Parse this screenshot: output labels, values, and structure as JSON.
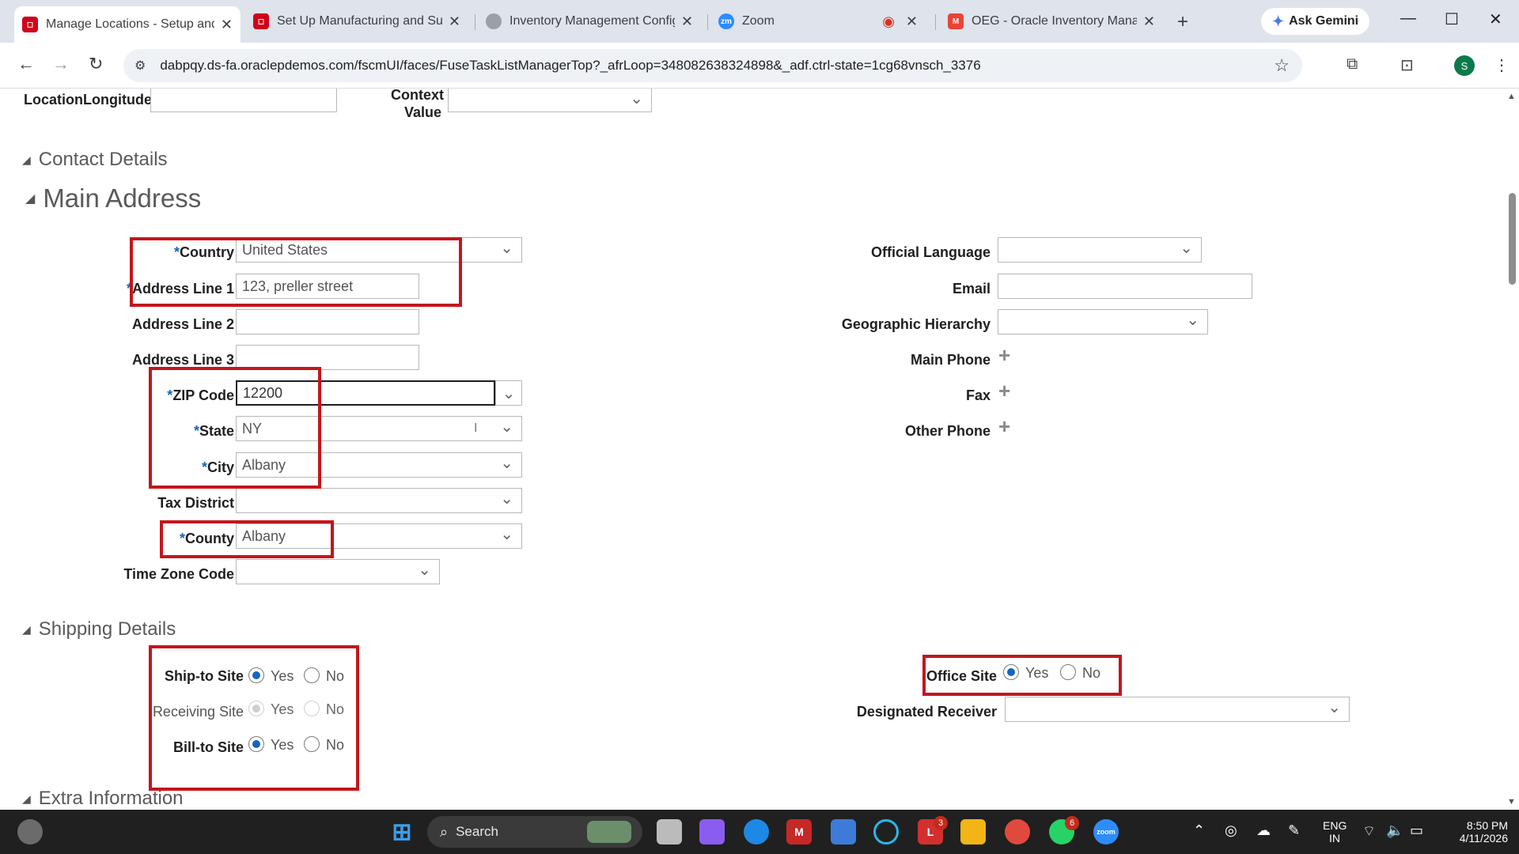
{
  "browser": {
    "tabs": [
      {
        "title": "Manage Locations - Setup and",
        "active": true,
        "favicon_color": "#d0021b"
      },
      {
        "title": "Set Up Manufacturing and Sup",
        "active": false,
        "favicon_color": "#d0021b"
      },
      {
        "title": "Inventory Management Config",
        "active": false,
        "favicon_color": "#888888"
      },
      {
        "title": "Zoom",
        "active": false,
        "favicon_color": "#2d8cff"
      },
      {
        "title": "OEG - Oracle Inventory Manag",
        "active": false,
        "favicon_color": "#ea4335"
      }
    ],
    "gemini_label": "Ask Gemini",
    "url": "dabpqy.ds-fa.oraclepdemos.com/fscmUI/faces/FuseTaskListManagerTop?_afrLoop=348082638324898&_adf.ctrl-state=1cg68vnsch_3376",
    "profile_initial": "S"
  },
  "top_fields": {
    "longitude_label": "LocationLongitude",
    "context_label_1": "Context",
    "context_label_2": "Value"
  },
  "sections": {
    "contact": "Contact Details",
    "main_address": "Main Address",
    "shipping": "Shipping Details",
    "extra": "Extra Information"
  },
  "address": {
    "country_label": "Country",
    "country_value": "United States",
    "line1_label": "Address Line 1",
    "line1_value": "123, preller street",
    "line2_label": "Address Line 2",
    "line3_label": "Address Line 3",
    "zip_label": "ZIP Code",
    "zip_value": "12200",
    "state_label": "State",
    "state_value": "NY",
    "city_label": "City",
    "city_value": "Albany",
    "tax_label": "Tax District",
    "county_label": "County",
    "county_value": "Albany",
    "tz_label": "Time Zone Code",
    "required_mark": "*"
  },
  "contact_right": {
    "language_label": "Official Language",
    "email_label": "Email",
    "geo_label": "Geographic Hierarchy",
    "main_phone_label": "Main Phone",
    "fax_label": "Fax",
    "other_phone_label": "Other Phone"
  },
  "shipping": {
    "ship_to_label": "Ship-to Site",
    "receiving_label": "Receiving Site",
    "bill_to_label": "Bill-to Site",
    "office_label": "Office Site",
    "designated_label": "Designated Receiver",
    "yes": "Yes",
    "no": "No"
  },
  "taskbar": {
    "search_label": "Search",
    "lang_1": "ENG",
    "lang_2": "IN",
    "time": "8:50 PM",
    "date": "4/11/2026",
    "badge_l": "3",
    "badge_whatsapp": "6"
  },
  "colors": {
    "highlight": "#c4161c",
    "required": "#1565c0"
  }
}
